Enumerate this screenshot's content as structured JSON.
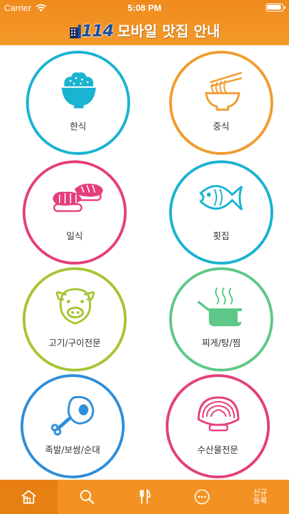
{
  "status_bar": {
    "carrier": "Carrier",
    "time": "5:08 PM"
  },
  "header": {
    "logo_number": "114",
    "title": "모바일 맛집 안내"
  },
  "categories": [
    {
      "label": "한식",
      "icon": "rice-bowl-icon",
      "color": "#1ab3d1"
    },
    {
      "label": "중식",
      "icon": "noodle-bowl-icon",
      "color": "#f29b30"
    },
    {
      "label": "일식",
      "icon": "sushi-icon",
      "color": "#e43f7c"
    },
    {
      "label": "횟집",
      "icon": "fish-icon",
      "color": "#1ab3d1"
    },
    {
      "label": "고기/구이전문",
      "icon": "pig-icon",
      "color": "#a5c534"
    },
    {
      "label": "찌게/탕/찜",
      "icon": "pot-icon",
      "color": "#5ec888"
    },
    {
      "label": "족발/보쌈/순대",
      "icon": "ham-leg-icon",
      "color": "#2f8ed8"
    },
    {
      "label": "수산물전문",
      "icon": "clam-icon",
      "color": "#e43f7c"
    }
  ],
  "tabbar": {
    "items": [
      {
        "name": "home",
        "icon": "home-icon"
      },
      {
        "name": "search",
        "icon": "search-icon"
      },
      {
        "name": "restaurant",
        "icon": "fork-knife-icon"
      },
      {
        "name": "more",
        "icon": "more-icon"
      },
      {
        "name": "register",
        "label": "신규\n등록"
      }
    ],
    "active": "home"
  }
}
